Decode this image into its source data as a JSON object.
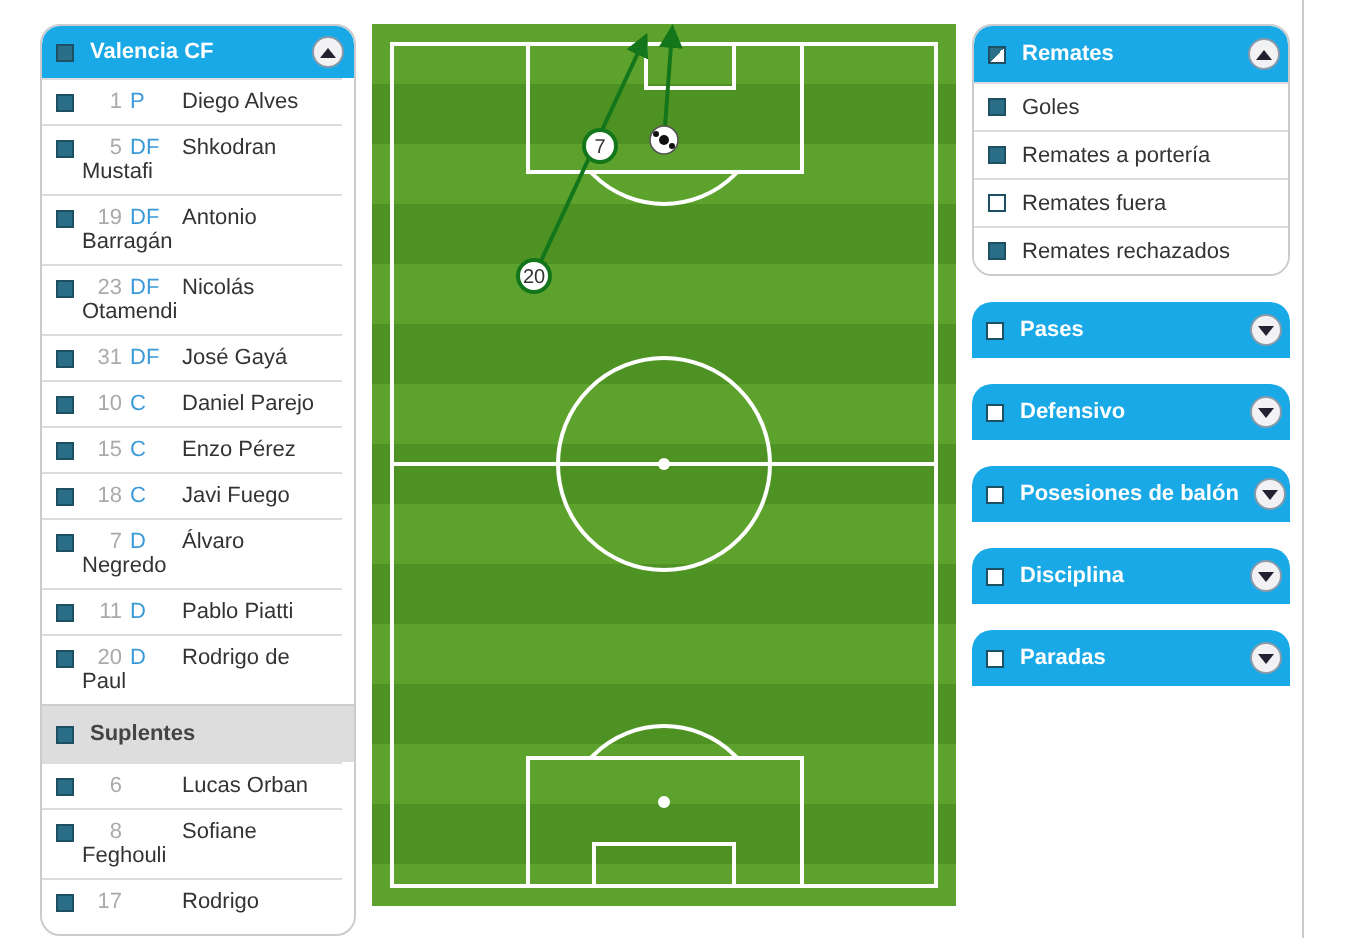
{
  "team_panel": {
    "title": "Valencia CF",
    "checked": true,
    "expanded": true,
    "starters": [
      {
        "number": "1",
        "position": "P",
        "name": "Diego Alves",
        "checked": true
      },
      {
        "number": "5",
        "position": "DF",
        "name": "Shkodran Mustafi",
        "checked": true
      },
      {
        "number": "19",
        "position": "DF",
        "name": "Antonio Barragán",
        "checked": true
      },
      {
        "number": "23",
        "position": "DF",
        "name": "Nicolás Otamendi",
        "checked": true
      },
      {
        "number": "31",
        "position": "DF",
        "name": "José Gayá",
        "checked": true
      },
      {
        "number": "10",
        "position": "C",
        "name": "Daniel Parejo",
        "checked": true
      },
      {
        "number": "15",
        "position": "C",
        "name": "Enzo Pérez",
        "checked": true
      },
      {
        "number": "18",
        "position": "C",
        "name": "Javi Fuego",
        "checked": true
      },
      {
        "number": "7",
        "position": "D",
        "name": "Álvaro Negredo",
        "checked": true
      },
      {
        "number": "11",
        "position": "D",
        "name": "Pablo Piatti",
        "checked": true
      },
      {
        "number": "20",
        "position": "D",
        "name": "Rodrigo de Paul",
        "checked": true
      }
    ],
    "subs_header": {
      "label": "Suplentes",
      "checked": true
    },
    "subs": [
      {
        "number": "6",
        "name": "Lucas Orban",
        "checked": true
      },
      {
        "number": "8",
        "name": "Sofiane Feghouli",
        "checked": true
      },
      {
        "number": "17",
        "name": "Rodrigo",
        "checked": true
      }
    ]
  },
  "pitch": {
    "shots": [
      {
        "kind": "marker",
        "label": "20",
        "via": "7"
      },
      {
        "kind": "ball"
      }
    ]
  },
  "stat_sections": [
    {
      "title": "Remates",
      "indeterminate": true,
      "expanded": true,
      "items": [
        {
          "label": "Goles",
          "checked": true
        },
        {
          "label": "Remates a portería",
          "checked": true
        },
        {
          "label": "Remates fuera",
          "checked": false
        },
        {
          "label": "Remates rechazados",
          "checked": true
        }
      ]
    },
    {
      "title": "Pases",
      "checked": false,
      "indeterminate": false,
      "expanded": false
    },
    {
      "title": "Defensivo",
      "checked": false,
      "indeterminate": false,
      "expanded": false
    },
    {
      "title": "Posesiones de balón",
      "checked": false,
      "indeterminate": false,
      "expanded": false
    },
    {
      "title": "Disciplina",
      "checked": false,
      "indeterminate": false,
      "expanded": false
    },
    {
      "title": "Paradas",
      "checked": false,
      "indeterminate": false,
      "expanded": false
    }
  ]
}
